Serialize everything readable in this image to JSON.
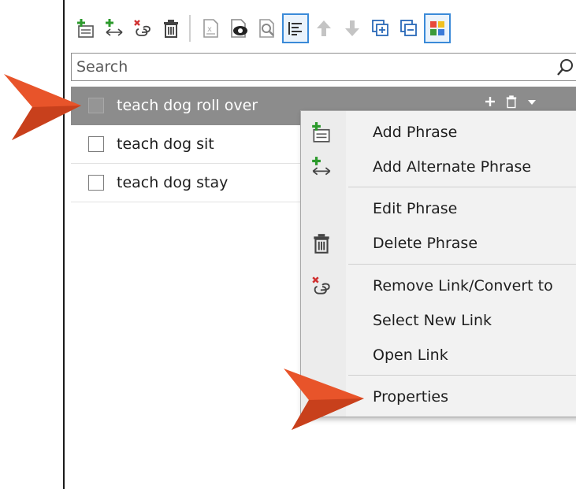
{
  "search": {
    "placeholder": "Search"
  },
  "toolbar": {
    "icons": [
      "add-phrase-icon",
      "add-alternate-phrase-icon",
      "remove-link-icon",
      "delete-icon",
      "edit-icon",
      "preview-icon",
      "view-icon",
      "align-icon",
      "move-up-icon",
      "move-down-icon",
      "expand-all-icon",
      "collapse-all-icon",
      "color-grid-icon"
    ]
  },
  "phrases": [
    {
      "label": "teach dog roll over",
      "selected": true
    },
    {
      "label": "teach dog sit",
      "selected": false
    },
    {
      "label": "teach dog stay",
      "selected": false
    }
  ],
  "context_menu": {
    "items": [
      {
        "label": "Add Phrase",
        "icon": "add-phrase-icon"
      },
      {
        "label": "Add Alternate Phrase",
        "icon": "add-alternate-phrase-icon"
      },
      {
        "label": "Edit Phrase",
        "icon": ""
      },
      {
        "label": "Delete Phrase",
        "icon": "delete-icon"
      },
      {
        "label": "Remove Link/Convert to",
        "icon": "remove-link-icon"
      },
      {
        "label": "Select New Link",
        "icon": ""
      },
      {
        "label": "Open Link",
        "icon": ""
      },
      {
        "label": "Properties",
        "icon": ""
      }
    ]
  },
  "colors": {
    "accent": "#e8542a",
    "selected_row": "#8c8c8c",
    "menu_bg": "#f2f2f2",
    "toolbar_active": "#3a8ad8"
  }
}
